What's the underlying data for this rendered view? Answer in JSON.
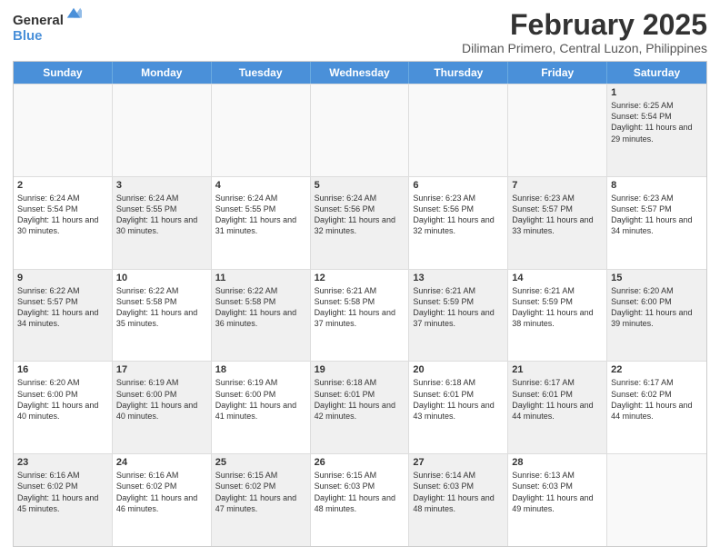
{
  "logo": {
    "general": "General",
    "blue": "Blue"
  },
  "header": {
    "month": "February 2025",
    "location": "Diliman Primero, Central Luzon, Philippines"
  },
  "weekdays": [
    "Sunday",
    "Monday",
    "Tuesday",
    "Wednesday",
    "Thursday",
    "Friday",
    "Saturday"
  ],
  "weeks": [
    [
      {
        "day": "",
        "info": "",
        "empty": true
      },
      {
        "day": "",
        "info": "",
        "empty": true
      },
      {
        "day": "",
        "info": "",
        "empty": true
      },
      {
        "day": "",
        "info": "",
        "empty": true
      },
      {
        "day": "",
        "info": "",
        "empty": true
      },
      {
        "day": "",
        "info": "",
        "empty": true
      },
      {
        "day": "1",
        "info": "Sunrise: 6:25 AM\nSunset: 5:54 PM\nDaylight: 11 hours and 29 minutes.",
        "shaded": true
      }
    ],
    [
      {
        "day": "2",
        "info": "Sunrise: 6:24 AM\nSunset: 5:54 PM\nDaylight: 11 hours and 30 minutes."
      },
      {
        "day": "3",
        "info": "Sunrise: 6:24 AM\nSunset: 5:55 PM\nDaylight: 11 hours and 30 minutes.",
        "shaded": true
      },
      {
        "day": "4",
        "info": "Sunrise: 6:24 AM\nSunset: 5:55 PM\nDaylight: 11 hours and 31 minutes."
      },
      {
        "day": "5",
        "info": "Sunrise: 6:24 AM\nSunset: 5:56 PM\nDaylight: 11 hours and 32 minutes.",
        "shaded": true
      },
      {
        "day": "6",
        "info": "Sunrise: 6:23 AM\nSunset: 5:56 PM\nDaylight: 11 hours and 32 minutes."
      },
      {
        "day": "7",
        "info": "Sunrise: 6:23 AM\nSunset: 5:57 PM\nDaylight: 11 hours and 33 minutes.",
        "shaded": true
      },
      {
        "day": "8",
        "info": "Sunrise: 6:23 AM\nSunset: 5:57 PM\nDaylight: 11 hours and 34 minutes."
      }
    ],
    [
      {
        "day": "9",
        "info": "Sunrise: 6:22 AM\nSunset: 5:57 PM\nDaylight: 11 hours and 34 minutes.",
        "shaded": true
      },
      {
        "day": "10",
        "info": "Sunrise: 6:22 AM\nSunset: 5:58 PM\nDaylight: 11 hours and 35 minutes."
      },
      {
        "day": "11",
        "info": "Sunrise: 6:22 AM\nSunset: 5:58 PM\nDaylight: 11 hours and 36 minutes.",
        "shaded": true
      },
      {
        "day": "12",
        "info": "Sunrise: 6:21 AM\nSunset: 5:58 PM\nDaylight: 11 hours and 37 minutes."
      },
      {
        "day": "13",
        "info": "Sunrise: 6:21 AM\nSunset: 5:59 PM\nDaylight: 11 hours and 37 minutes.",
        "shaded": true
      },
      {
        "day": "14",
        "info": "Sunrise: 6:21 AM\nSunset: 5:59 PM\nDaylight: 11 hours and 38 minutes."
      },
      {
        "day": "15",
        "info": "Sunrise: 6:20 AM\nSunset: 6:00 PM\nDaylight: 11 hours and 39 minutes.",
        "shaded": true
      }
    ],
    [
      {
        "day": "16",
        "info": "Sunrise: 6:20 AM\nSunset: 6:00 PM\nDaylight: 11 hours and 40 minutes."
      },
      {
        "day": "17",
        "info": "Sunrise: 6:19 AM\nSunset: 6:00 PM\nDaylight: 11 hours and 40 minutes.",
        "shaded": true
      },
      {
        "day": "18",
        "info": "Sunrise: 6:19 AM\nSunset: 6:00 PM\nDaylight: 11 hours and 41 minutes."
      },
      {
        "day": "19",
        "info": "Sunrise: 6:18 AM\nSunset: 6:01 PM\nDaylight: 11 hours and 42 minutes.",
        "shaded": true
      },
      {
        "day": "20",
        "info": "Sunrise: 6:18 AM\nSunset: 6:01 PM\nDaylight: 11 hours and 43 minutes."
      },
      {
        "day": "21",
        "info": "Sunrise: 6:17 AM\nSunset: 6:01 PM\nDaylight: 11 hours and 44 minutes.",
        "shaded": true
      },
      {
        "day": "22",
        "info": "Sunrise: 6:17 AM\nSunset: 6:02 PM\nDaylight: 11 hours and 44 minutes."
      }
    ],
    [
      {
        "day": "23",
        "info": "Sunrise: 6:16 AM\nSunset: 6:02 PM\nDaylight: 11 hours and 45 minutes.",
        "shaded": true
      },
      {
        "day": "24",
        "info": "Sunrise: 6:16 AM\nSunset: 6:02 PM\nDaylight: 11 hours and 46 minutes."
      },
      {
        "day": "25",
        "info": "Sunrise: 6:15 AM\nSunset: 6:02 PM\nDaylight: 11 hours and 47 minutes.",
        "shaded": true
      },
      {
        "day": "26",
        "info": "Sunrise: 6:15 AM\nSunset: 6:03 PM\nDaylight: 11 hours and 48 minutes."
      },
      {
        "day": "27",
        "info": "Sunrise: 6:14 AM\nSunset: 6:03 PM\nDaylight: 11 hours and 48 minutes.",
        "shaded": true
      },
      {
        "day": "28",
        "info": "Sunrise: 6:13 AM\nSunset: 6:03 PM\nDaylight: 11 hours and 49 minutes."
      },
      {
        "day": "",
        "info": "",
        "empty": true
      }
    ]
  ]
}
